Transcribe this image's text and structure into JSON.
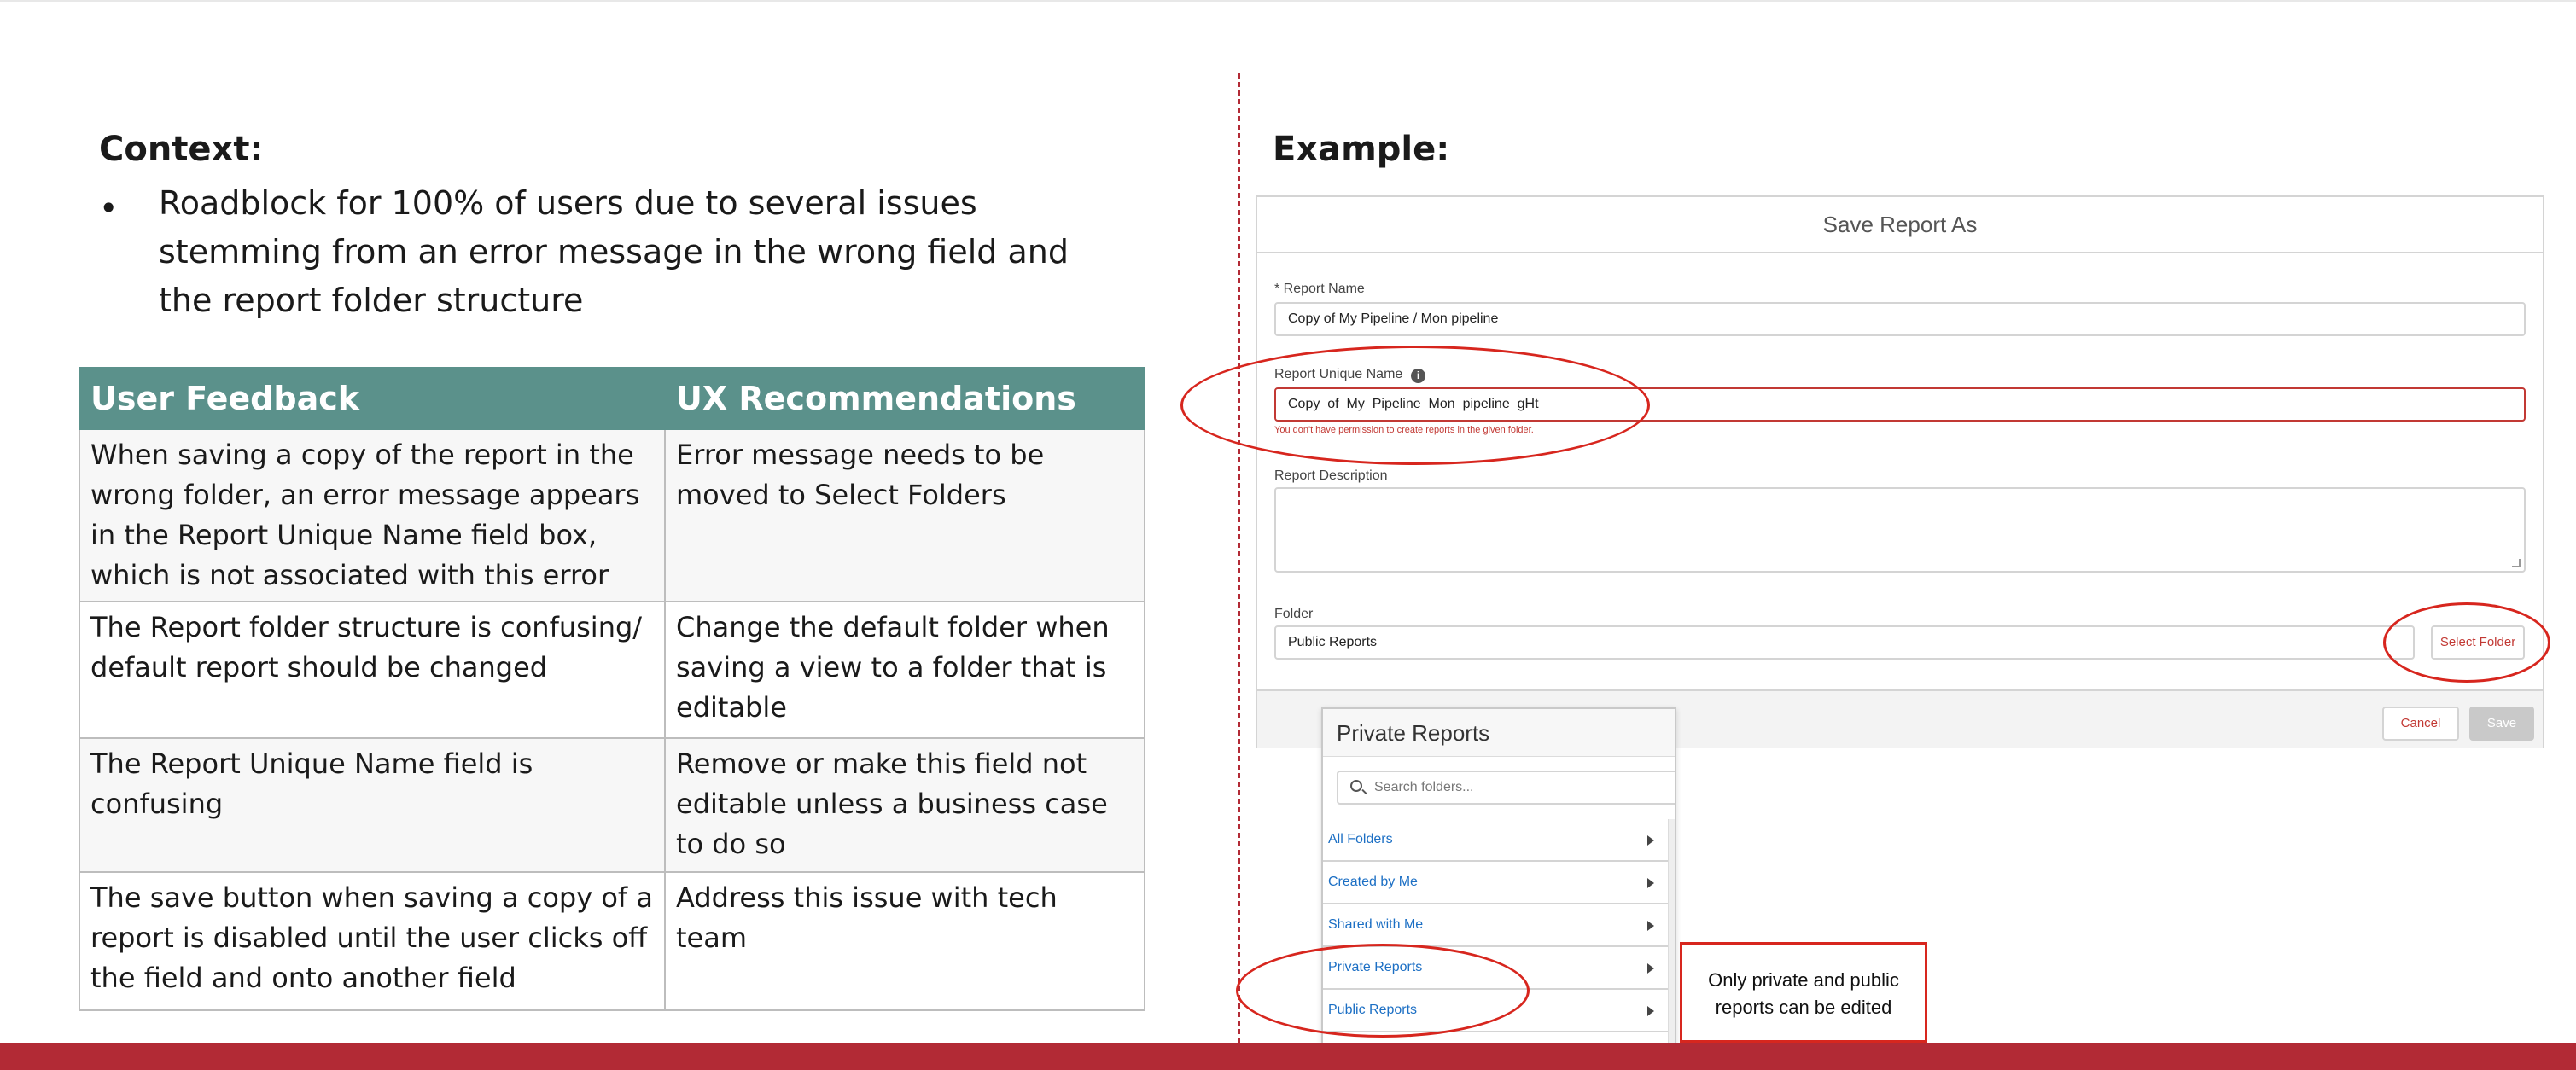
{
  "context": {
    "title": "Context:",
    "bullet_marker": "•",
    "bullet_text": "Roadblock for 100% of users due to several issues stemming from an error message in the wrong field and the report folder structure"
  },
  "table": {
    "headers": [
      "User Feedback",
      "UX Recommendations"
    ],
    "rows": [
      {
        "feedback": "When saving a copy of the report in the wrong folder, an error message appears in the Report Unique Name field box, which is not associated with this error",
        "recommendation": "Error message needs to be moved to Select Folders"
      },
      {
        "feedback": "The Report folder structure is confusing/ default report should be changed",
        "recommendation": "Change the default folder when saving a view to a folder that is editable"
      },
      {
        "feedback": "The Report Unique Name field is confusing",
        "recommendation": "Remove or make this field not editable unless a business case to do so"
      },
      {
        "feedback": "The save button when saving a copy of a report is disabled until the user clicks off the field and onto another field",
        "recommendation": "Address this issue with tech team"
      }
    ]
  },
  "example": {
    "title": "Example:"
  },
  "modal": {
    "title": "Save Report As",
    "report_name_label": "* Report Name",
    "report_name_value": "Copy of My Pipeline / Mon pipeline",
    "unique_name_label": "Report Unique Name",
    "info_icon_glyph": "i",
    "unique_name_value": "Copy_of_My_Pipeline_Mon_pipeline_gHt",
    "unique_name_error": "You don't have permission to create reports in the given folder.",
    "description_label": "Report Description",
    "folder_label": "Folder",
    "folder_value": "Public Reports",
    "select_folder_label": "Select Folder",
    "cancel_label": "Cancel",
    "save_label": "Save"
  },
  "folder_dropdown": {
    "title": "Private Reports",
    "search_placeholder": "Search folders...",
    "items": [
      "All Folders",
      "Created by Me",
      "Shared with Me",
      "Private Reports",
      "Public Reports"
    ]
  },
  "callout": {
    "text": "Only private and public reports can be edited"
  },
  "colors": {
    "table_header": "#5b918b",
    "brand_bar": "#b22a35",
    "annotation_red": "#d7261e",
    "link_blue": "#1c6fc4"
  }
}
